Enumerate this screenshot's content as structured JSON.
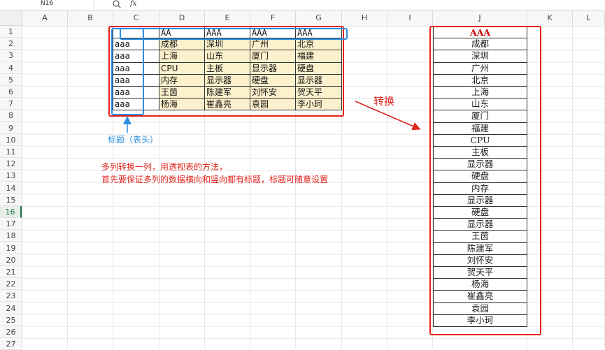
{
  "formula_bar": {
    "name_box": "N16",
    "fx": "fx",
    "formula": ""
  },
  "columns": [
    "A",
    "B",
    "C",
    "D",
    "E",
    "F",
    "G",
    "H",
    "I",
    "J",
    "K",
    "L"
  ],
  "rows": [
    "1",
    "2",
    "3",
    "4",
    "5",
    "6",
    "7",
    "8",
    "9",
    "10",
    "11",
    "12",
    "13",
    "14",
    "15",
    "16",
    "17",
    "18",
    "19",
    "20",
    "21",
    "22",
    "23",
    "24",
    "25",
    "26",
    "27"
  ],
  "active_row": "16",
  "source_table": {
    "headers": [
      "AA",
      "AAA",
      "AAA",
      "AAA"
    ],
    "rows": [
      {
        "label": "aaa",
        "cells": [
          "成都",
          "深圳",
          "广州",
          "北京"
        ]
      },
      {
        "label": "aaa",
        "cells": [
          "上海",
          "山东",
          "厦门",
          "福建"
        ]
      },
      {
        "label": "aaa",
        "cells": [
          "CPU",
          "主板",
          "显示器",
          "硬盘"
        ]
      },
      {
        "label": "aaa",
        "cells": [
          "内存",
          "显示器",
          "硬盘",
          "显示器"
        ]
      },
      {
        "label": "aaa",
        "cells": [
          "王茵",
          "陈建军",
          "刘怀安",
          "贺天平"
        ]
      },
      {
        "label": "aaa",
        "cells": [
          "杨海",
          "崔鑫亮",
          "袁园",
          "李小珂"
        ]
      }
    ]
  },
  "output_column": {
    "header": "AAA",
    "values": [
      "成都",
      "深圳",
      "广州",
      "北京",
      "上海",
      "山东",
      "厦门",
      "福建",
      "CPU",
      "主板",
      "显示器",
      "硬盘",
      "内存",
      "显示器",
      "硬盘",
      "显示器",
      "王茵",
      "陈建军",
      "刘怀安",
      "贺天平",
      "杨海",
      "崔鑫亮",
      "袁园",
      "李小珂"
    ]
  },
  "annotations": {
    "title_note": "标题（表头）",
    "line1": "多列转换一列，用透视表的方法，",
    "line2": "首先要保证多列的数据横向和竖向都有标题，标题可随意设置",
    "transform": "转换"
  },
  "colors": {
    "red": "#e8201a",
    "blue": "#2c8fe0",
    "cell_fill": "#fdf1cd",
    "header_text": "#c00000"
  }
}
